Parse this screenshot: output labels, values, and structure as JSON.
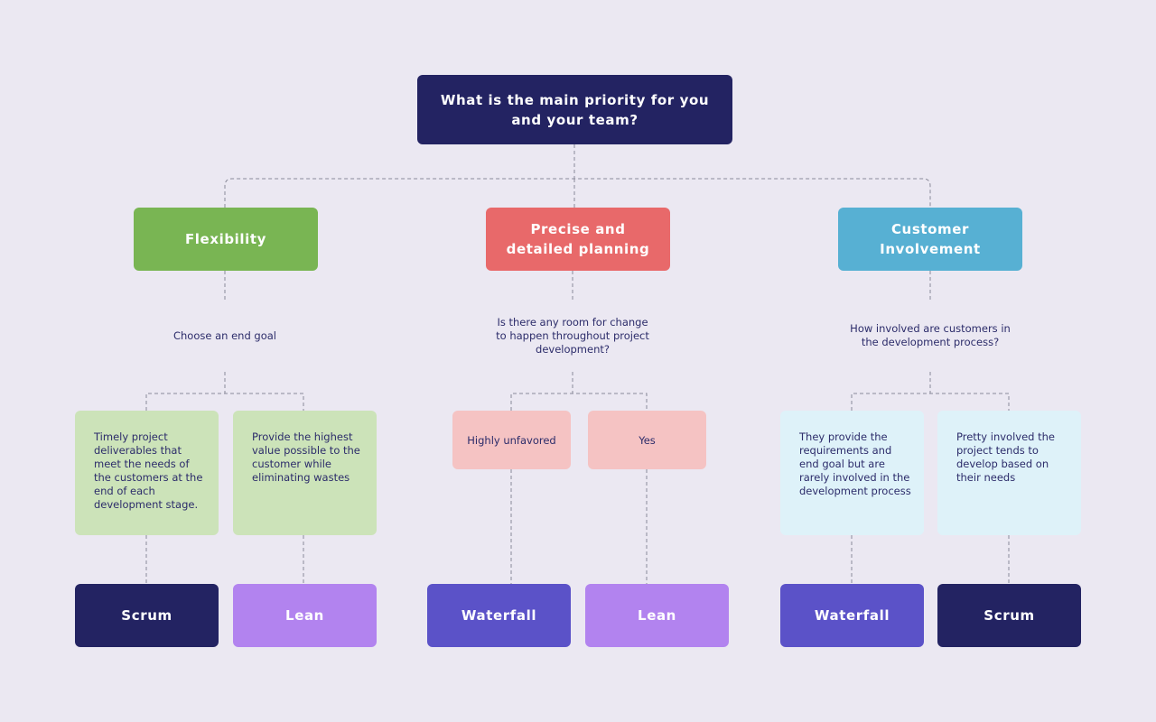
{
  "root": {
    "question": "What is the main priority for you and your team?"
  },
  "colors": {
    "root": "#232362",
    "flexibility": "#79b553",
    "planning": "#e8696a",
    "customer": "#57b0d3",
    "scrum": "#232362",
    "lean": "#b283ef",
    "waterfall": "#5b52c8",
    "green_light": "#cce3b9",
    "pink_light": "#f5c3c3",
    "blue_light": "#def2f9"
  },
  "branches": [
    {
      "label": "Flexibility",
      "question": "Choose an end goal",
      "options": [
        {
          "text": "Timely project deliverables that meet the needs of the customers at the end of each development stage.",
          "result": "Scrum"
        },
        {
          "text": "Provide the highest value possible to the customer while eliminating wastes",
          "result": "Lean"
        }
      ]
    },
    {
      "label": "Precise and detailed planning",
      "question": "Is there any room for change to happen throughout project development?",
      "options": [
        {
          "text": "Highly unfavored",
          "result": "Waterfall"
        },
        {
          "text": "Yes",
          "result": "Lean"
        }
      ]
    },
    {
      "label": "Customer Involvement",
      "question": "How involved are customers in the development process?",
      "options": [
        {
          "text": "They provide the requirements and end goal but are rarely involved in the development process",
          "result": "Waterfall"
        },
        {
          "text": "Pretty involved the project tends to develop based on their needs",
          "result": "Scrum"
        }
      ]
    }
  ]
}
